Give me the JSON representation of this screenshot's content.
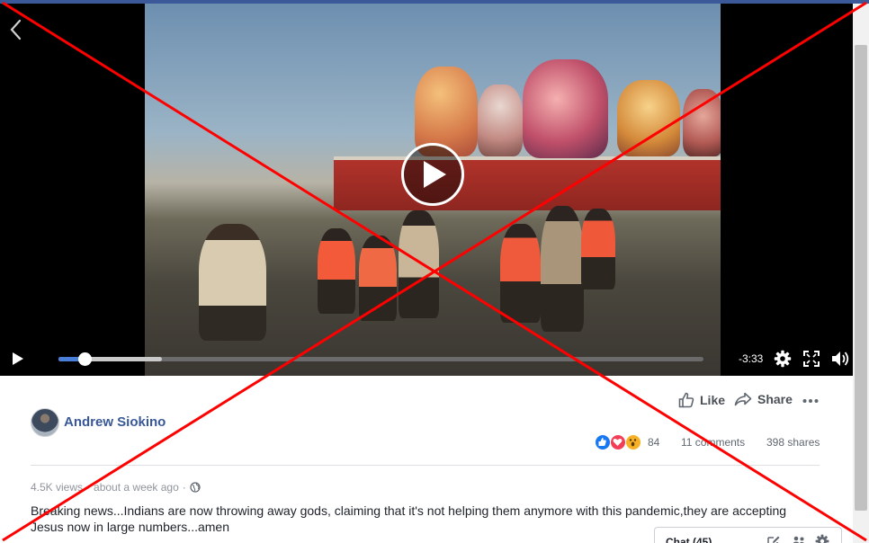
{
  "video": {
    "time_remaining": "-3:33",
    "progress_fraction": 0.04,
    "buffered_fraction": 0.16
  },
  "post": {
    "author": "Andrew Siokino",
    "actions": {
      "like": "Like",
      "share": "Share"
    },
    "reaction_count": "84",
    "comments": "11 comments",
    "shares": "398 shares",
    "views": "4.5K views",
    "time": "about a week ago",
    "caption": "Breaking news...Indians are now throwing away gods, claiming that it's not helping them anymore with this pandemic,they are accepting Jesus now in large numbers...amen"
  },
  "chat": {
    "label": "Chat (45)"
  },
  "icons": {
    "back": "chevron-left-icon",
    "play": "play-icon",
    "settings": "gear-icon",
    "fullscreen": "fullscreen-icon",
    "volume": "volume-icon",
    "like": "thumbs-up-icon",
    "share": "share-arrow-icon",
    "more": "more-icon",
    "privacy": "globe-icon"
  },
  "colors": {
    "accent": "#3b5998",
    "progress": "#4a7fd9",
    "overlay_cross": "#ff0000"
  }
}
